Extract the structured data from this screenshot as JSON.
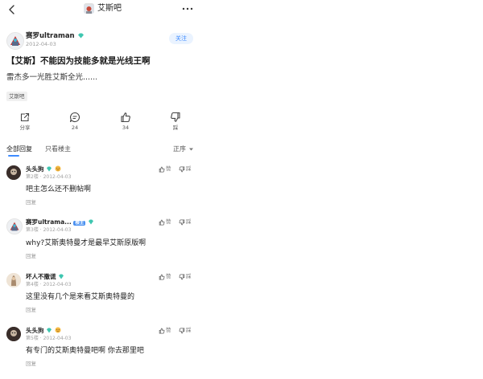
{
  "header": {
    "title": "艾斯吧",
    "more_label": "···"
  },
  "post": {
    "author": "赛罗ultraman",
    "date": "2012-04-03",
    "follow_label": "关注",
    "title": "【艾斯】不能因为技能多就是光线王啊",
    "body": "雷杰多一光胜艾斯全光......",
    "forum_tag": "艾斯吧"
  },
  "actions": [
    {
      "label": "分享",
      "icon": "share-icon"
    },
    {
      "label": "24",
      "icon": "comment-icon"
    },
    {
      "label": "34",
      "icon": "thumbs-up-icon"
    },
    {
      "label": "踩",
      "icon": "thumbs-down-icon"
    }
  ],
  "tabs": {
    "all": "全部回复",
    "op_only": "只看楼主",
    "sort": "正序"
  },
  "comments": [
    {
      "user": "头头狗",
      "floor": "第2楼",
      "date": "2012-04-03",
      "text": "吧主怎么还不删帖啊",
      "reply": "回复",
      "like": "赞",
      "dislike": "踩",
      "louzhu": ""
    },
    {
      "user": "赛罗ultrama...",
      "floor": "第3楼",
      "date": "2012-04-03",
      "text": "why?艾斯奥特曼才是最早艾斯原版啊",
      "reply": "回复",
      "like": "赞",
      "dislike": "踩",
      "louzhu": "楼主"
    },
    {
      "user": "坏人不撒谎",
      "floor": "第4楼",
      "date": "2012-04-03",
      "text": "这里没有几个是来看艾斯奥特曼的",
      "reply": "回复",
      "like": "赞",
      "dislike": "踩",
      "louzhu": ""
    },
    {
      "user": "头头狗",
      "floor": "第5楼",
      "date": "2012-04-03",
      "text": "有专门的艾斯奥特曼吧啊 你去那里吧",
      "reply": "回复",
      "like": "赞",
      "dislike": "踩",
      "louzhu": ""
    }
  ],
  "colors": {
    "accent": "#3d8bff",
    "gem": "#3ec6b0",
    "muted": "#9a9a9a"
  }
}
